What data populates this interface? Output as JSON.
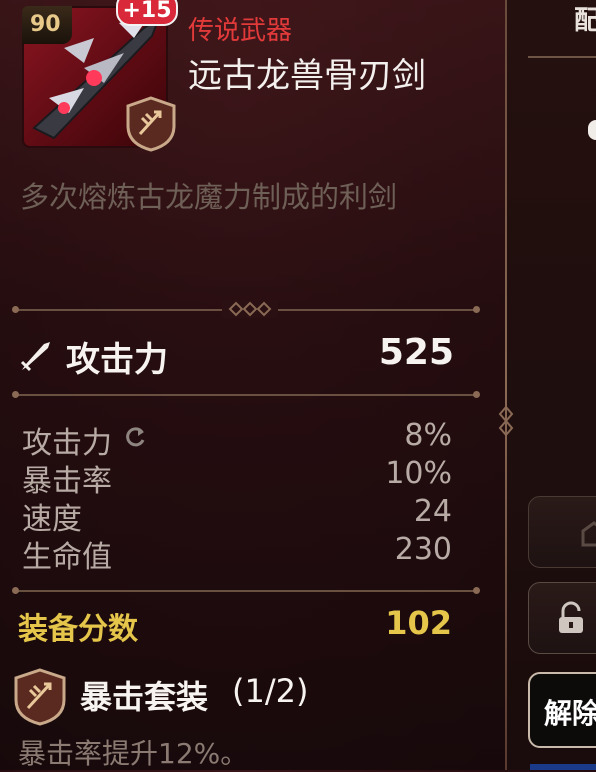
{
  "item": {
    "level": "90",
    "enhance": "+15",
    "rarity": "传说武器",
    "name": "远古龙兽骨刃剑",
    "description": "多次熔炼古龙魔力制成的利剑"
  },
  "main_stat": {
    "label": "攻击力",
    "value": "525"
  },
  "sub_stats": [
    {
      "label": "攻击力",
      "value": "8%"
    },
    {
      "label": "暴击率",
      "value": "10%"
    },
    {
      "label": "速度",
      "value": "24"
    },
    {
      "label": "生命值",
      "value": "230"
    }
  ],
  "gear_score": {
    "label": "装备分数",
    "value": "102"
  },
  "set": {
    "name": "暴击套装",
    "count": "(1/2)",
    "effect": "暴击率提升12%。"
  },
  "right_panel": {
    "title_fragment": "配",
    "unlock_label": "解除"
  },
  "colors": {
    "rarity": "#e23a3a",
    "score": "#e5c64a",
    "enhance_badge": "#d8283a"
  },
  "icons": {
    "main_stat": "sword-icon",
    "reforge": "refresh-icon",
    "set": "crit-set-icon"
  }
}
